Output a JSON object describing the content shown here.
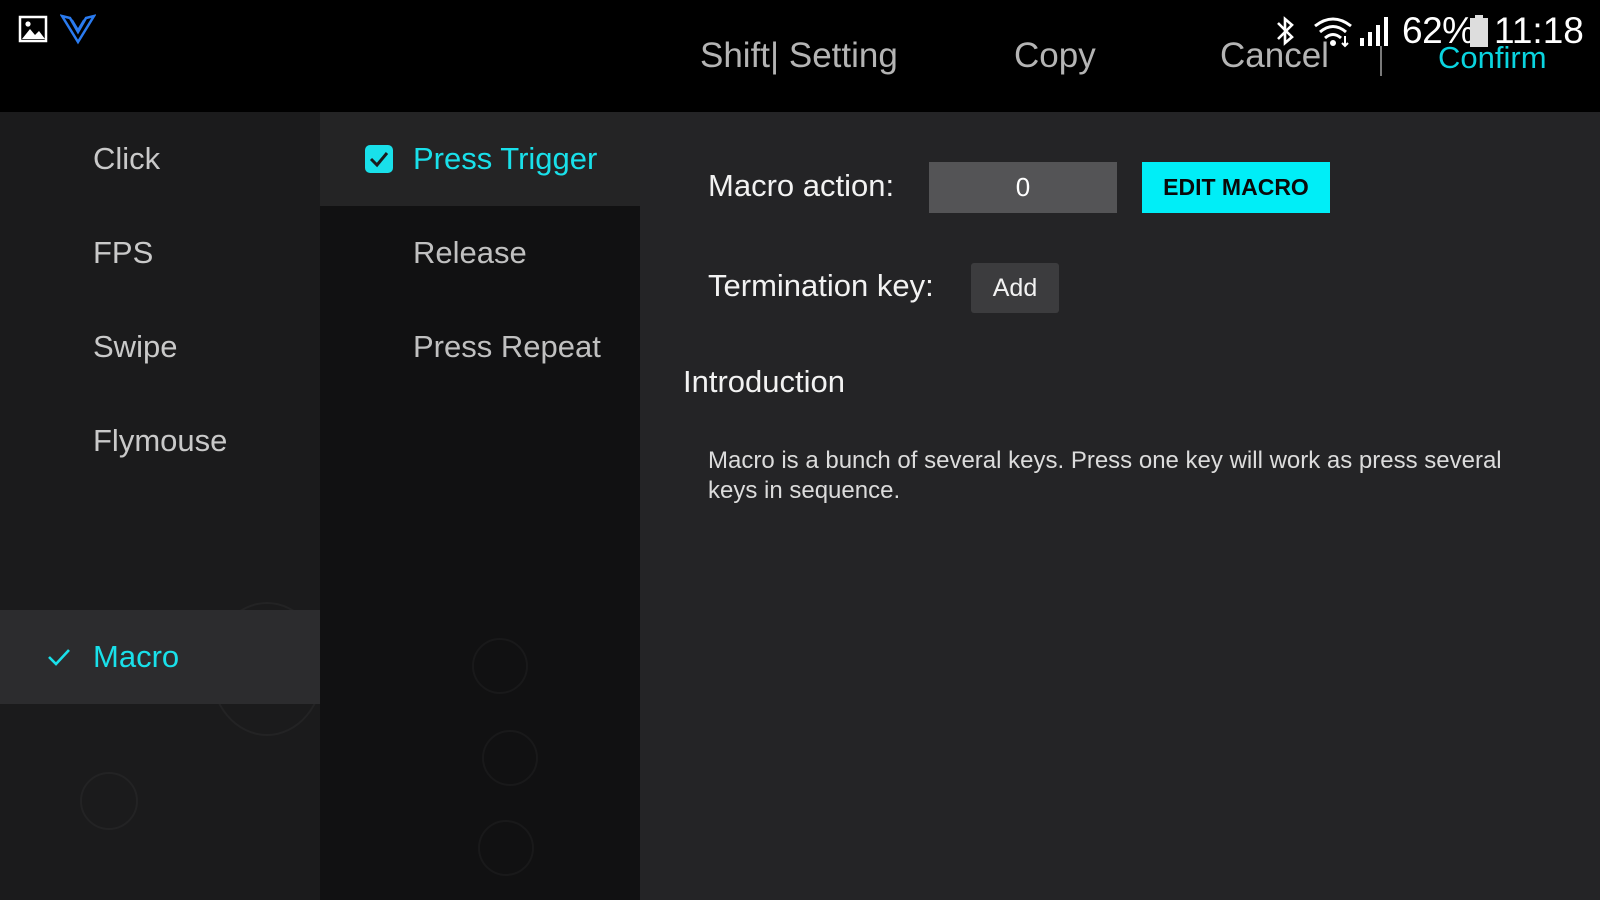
{
  "status_bar": {
    "battery_percent": "62%",
    "time": "11:18",
    "icons": [
      "gallery-icon",
      "app-logo-icon",
      "bluetooth-icon",
      "wifi-icon",
      "signal-icon",
      "battery-icon"
    ]
  },
  "header": {
    "actions": [
      {
        "label": "Shift| Setting"
      },
      {
        "label": "Copy"
      },
      {
        "label": "Cancel"
      },
      {
        "label": "Confirm"
      }
    ]
  },
  "categories": {
    "items": [
      {
        "label": "Click",
        "selected": false
      },
      {
        "label": "FPS",
        "selected": false
      },
      {
        "label": "Swipe",
        "selected": false
      },
      {
        "label": "Flymouse",
        "selected": false
      },
      {
        "label": "Macro",
        "selected": true
      }
    ]
  },
  "modes": {
    "items": [
      {
        "label": "Press Trigger",
        "selected": true
      },
      {
        "label": "Release",
        "selected": false
      },
      {
        "label": "Press Repeat",
        "selected": false
      }
    ]
  },
  "panel": {
    "macro_action_label": "Macro action:",
    "macro_action_value": "0",
    "edit_macro_label": "EDIT MACRO",
    "termination_label": "Termination key:",
    "add_label": "Add",
    "intro_heading": "Introduction",
    "intro_text": "Macro is a bunch of several keys. Press one key will work as press several keys in sequence."
  },
  "colors": {
    "accent": "#19e0ea",
    "button_accent": "#00eef7",
    "background": "#242426"
  }
}
